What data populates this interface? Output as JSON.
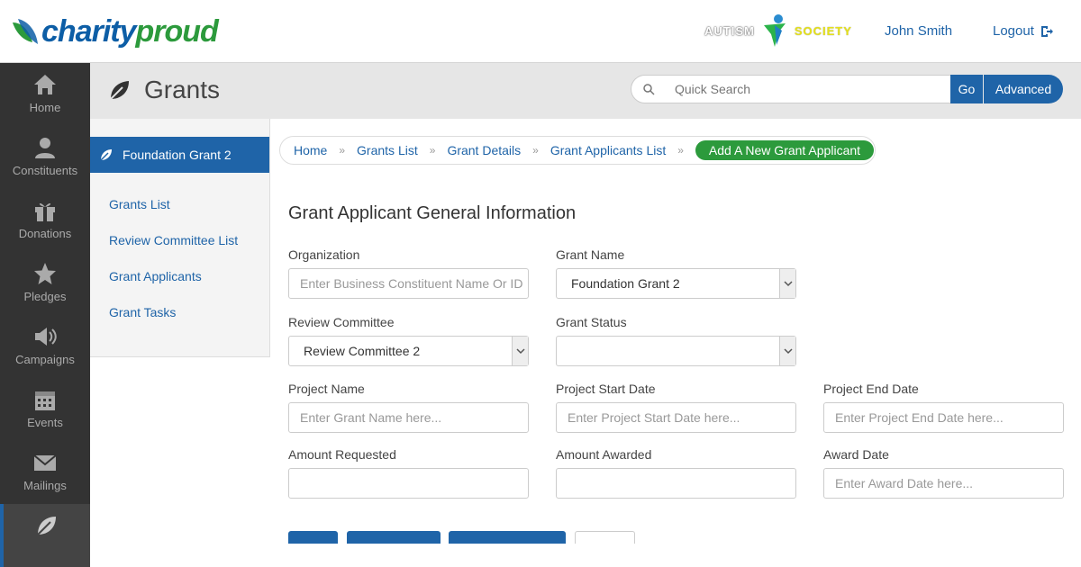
{
  "topbar": {
    "logo_part1": "charity",
    "logo_part2": "proud",
    "org_logo_word1": "AUTISM",
    "org_logo_word2": "SOCIETY",
    "user": "John Smith",
    "logout": "Logout"
  },
  "leftnav": {
    "items": [
      {
        "label": "Home",
        "icon": "home-icon"
      },
      {
        "label": "Constituents",
        "icon": "person-icon"
      },
      {
        "label": "Donations",
        "icon": "gift-icon"
      },
      {
        "label": "Pledges",
        "icon": "star-icon"
      },
      {
        "label": "Campaigns",
        "icon": "megaphone-icon"
      },
      {
        "label": "Events",
        "icon": "calendar-icon"
      },
      {
        "label": "Mailings",
        "icon": "envelope-icon"
      },
      {
        "label": "",
        "icon": "leaf-icon"
      }
    ]
  },
  "header": {
    "title": "Grants",
    "search_placeholder": "Quick Search",
    "go": "Go",
    "advanced": "Advanced"
  },
  "subside": {
    "heading": "Foundation Grant 2",
    "items": [
      "Grants List",
      "Review Committee List",
      "Grant Applicants",
      "Grant Tasks"
    ]
  },
  "breadcrumb": {
    "items": [
      "Home",
      "Grants List",
      "Grant Details",
      "Grant Applicants List"
    ],
    "current": "Add A New Grant Applicant"
  },
  "form": {
    "title": "Grant Applicant General Information",
    "organization": {
      "label": "Organization",
      "placeholder": "Enter Business Constituent Name Or ID"
    },
    "grant_name": {
      "label": "Grant Name",
      "value": "Foundation Grant 2"
    },
    "review_committee": {
      "label": "Review Committee",
      "value": "Review Committee 2"
    },
    "grant_status": {
      "label": "Grant Status",
      "value": ""
    },
    "project_name": {
      "label": "Project Name",
      "placeholder": "Enter Grant Name here..."
    },
    "project_start": {
      "label": "Project Start Date",
      "placeholder": "Enter Project Start Date here..."
    },
    "project_end": {
      "label": "Project End Date",
      "placeholder": "Enter Project End Date here..."
    },
    "amount_requested": {
      "label": "Amount Requested",
      "placeholder": ""
    },
    "amount_awarded": {
      "label": "Amount Awarded",
      "placeholder": ""
    },
    "award_date": {
      "label": "Award Date",
      "placeholder": "Enter Award Date here..."
    }
  },
  "colors": {
    "primary": "#1f64a8",
    "accent_green": "#2c9a3c",
    "nav_bg": "#333333"
  }
}
